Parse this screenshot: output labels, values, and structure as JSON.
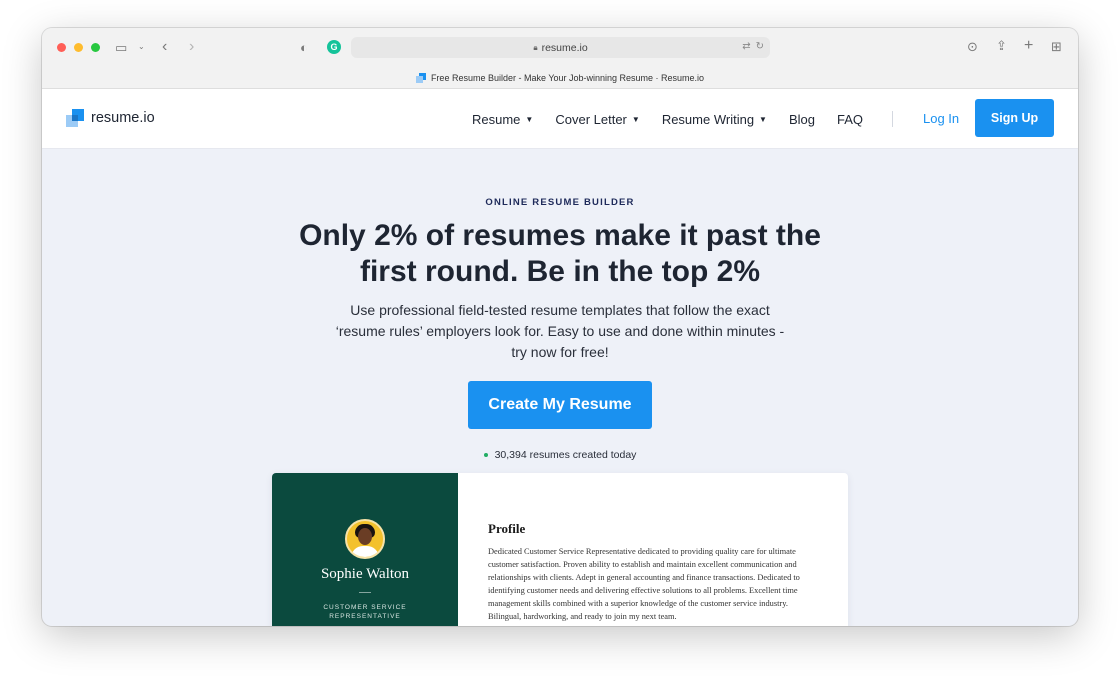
{
  "browser": {
    "url": "resume.io",
    "tab_title": "Free Resume Builder - Make Your Job-winning Resume · Resume.io",
    "icons": [
      "sidebar-icon",
      "chevron-down-icon",
      "back-icon",
      "forward-icon",
      "privacy-shield-icon",
      "grammarly-icon",
      "lock-icon",
      "translate-icon",
      "reload-icon",
      "download-icon",
      "share-icon",
      "new-tab-icon",
      "tab-overview-icon"
    ],
    "grammarly_letter": "G"
  },
  "navbar": {
    "logo_text": "resume.io",
    "links": [
      {
        "label": "Resume",
        "has_dropdown": true
      },
      {
        "label": "Cover Letter",
        "has_dropdown": true
      },
      {
        "label": "Resume Writing",
        "has_dropdown": true
      },
      {
        "label": "Blog",
        "has_dropdown": false
      },
      {
        "label": "FAQ",
        "has_dropdown": false
      }
    ],
    "login_label": "Log In",
    "signup_label": "Sign Up"
  },
  "hero": {
    "eyebrow": "ONLINE RESUME BUILDER",
    "headline": "Only 2% of resumes make it past the first round. Be in the top 2%",
    "subtext": "Use professional field-tested resume templates that follow the exact ‘resume rules’ employers look for. Easy to use and done within minutes - try now for free!",
    "cta_label": "Create My Resume",
    "counter_text": "30,394 resumes created today"
  },
  "resume_preview": {
    "name": "Sophie Walton",
    "role": "CUSTOMER SERVICE REPRESENTATIVE",
    "section_title": "Profile",
    "profile_text": "Dedicated Customer Service Representative dedicated to providing quality care for ultimate customer satisfaction. Proven ability to establish and maintain excellent communication and relationships with clients. Adept in general accounting and finance transactions. Dedicated to identifying customer needs and delivering effective solutions to all problems. Excellent time management skills combined with a superior knowledge of the customer service industry. Bilingual, hardworking, and ready to join my next team."
  },
  "colors": {
    "accent": "#1a91f0",
    "hero_bg": "#eef1f8",
    "resume_sidebar": "#0b4a3e",
    "text_dark": "#1e2532",
    "status_dot": "#21ad64"
  }
}
